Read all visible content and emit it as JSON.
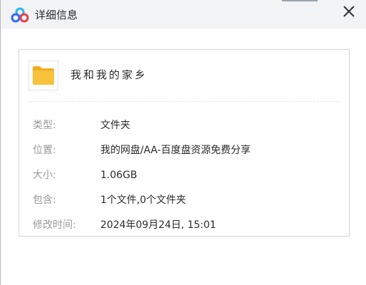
{
  "window": {
    "title": "详细信息"
  },
  "icons": {
    "app": "baidu-netdisk-logo-icon",
    "folder": "folder-icon",
    "close": "close-icon"
  },
  "colors": {
    "folder_yellow": "#f9c23c",
    "logo_blue": "#2e6bf0",
    "logo_cyan": "#26b6f0",
    "logo_red": "#ee3d4a"
  },
  "file": {
    "name": "我和我的家乡"
  },
  "details": [
    {
      "label": "类型:",
      "value": "文件夹"
    },
    {
      "label": "位置:",
      "value": "我的网盘/AA-百度盘资源免费分享"
    },
    {
      "label": "大小:",
      "value": "1.06GB"
    },
    {
      "label": "包含:",
      "value": "1个文件,0个文件夹"
    },
    {
      "label": "修改时间:",
      "value": "2024年09月24日, 15:01"
    }
  ]
}
